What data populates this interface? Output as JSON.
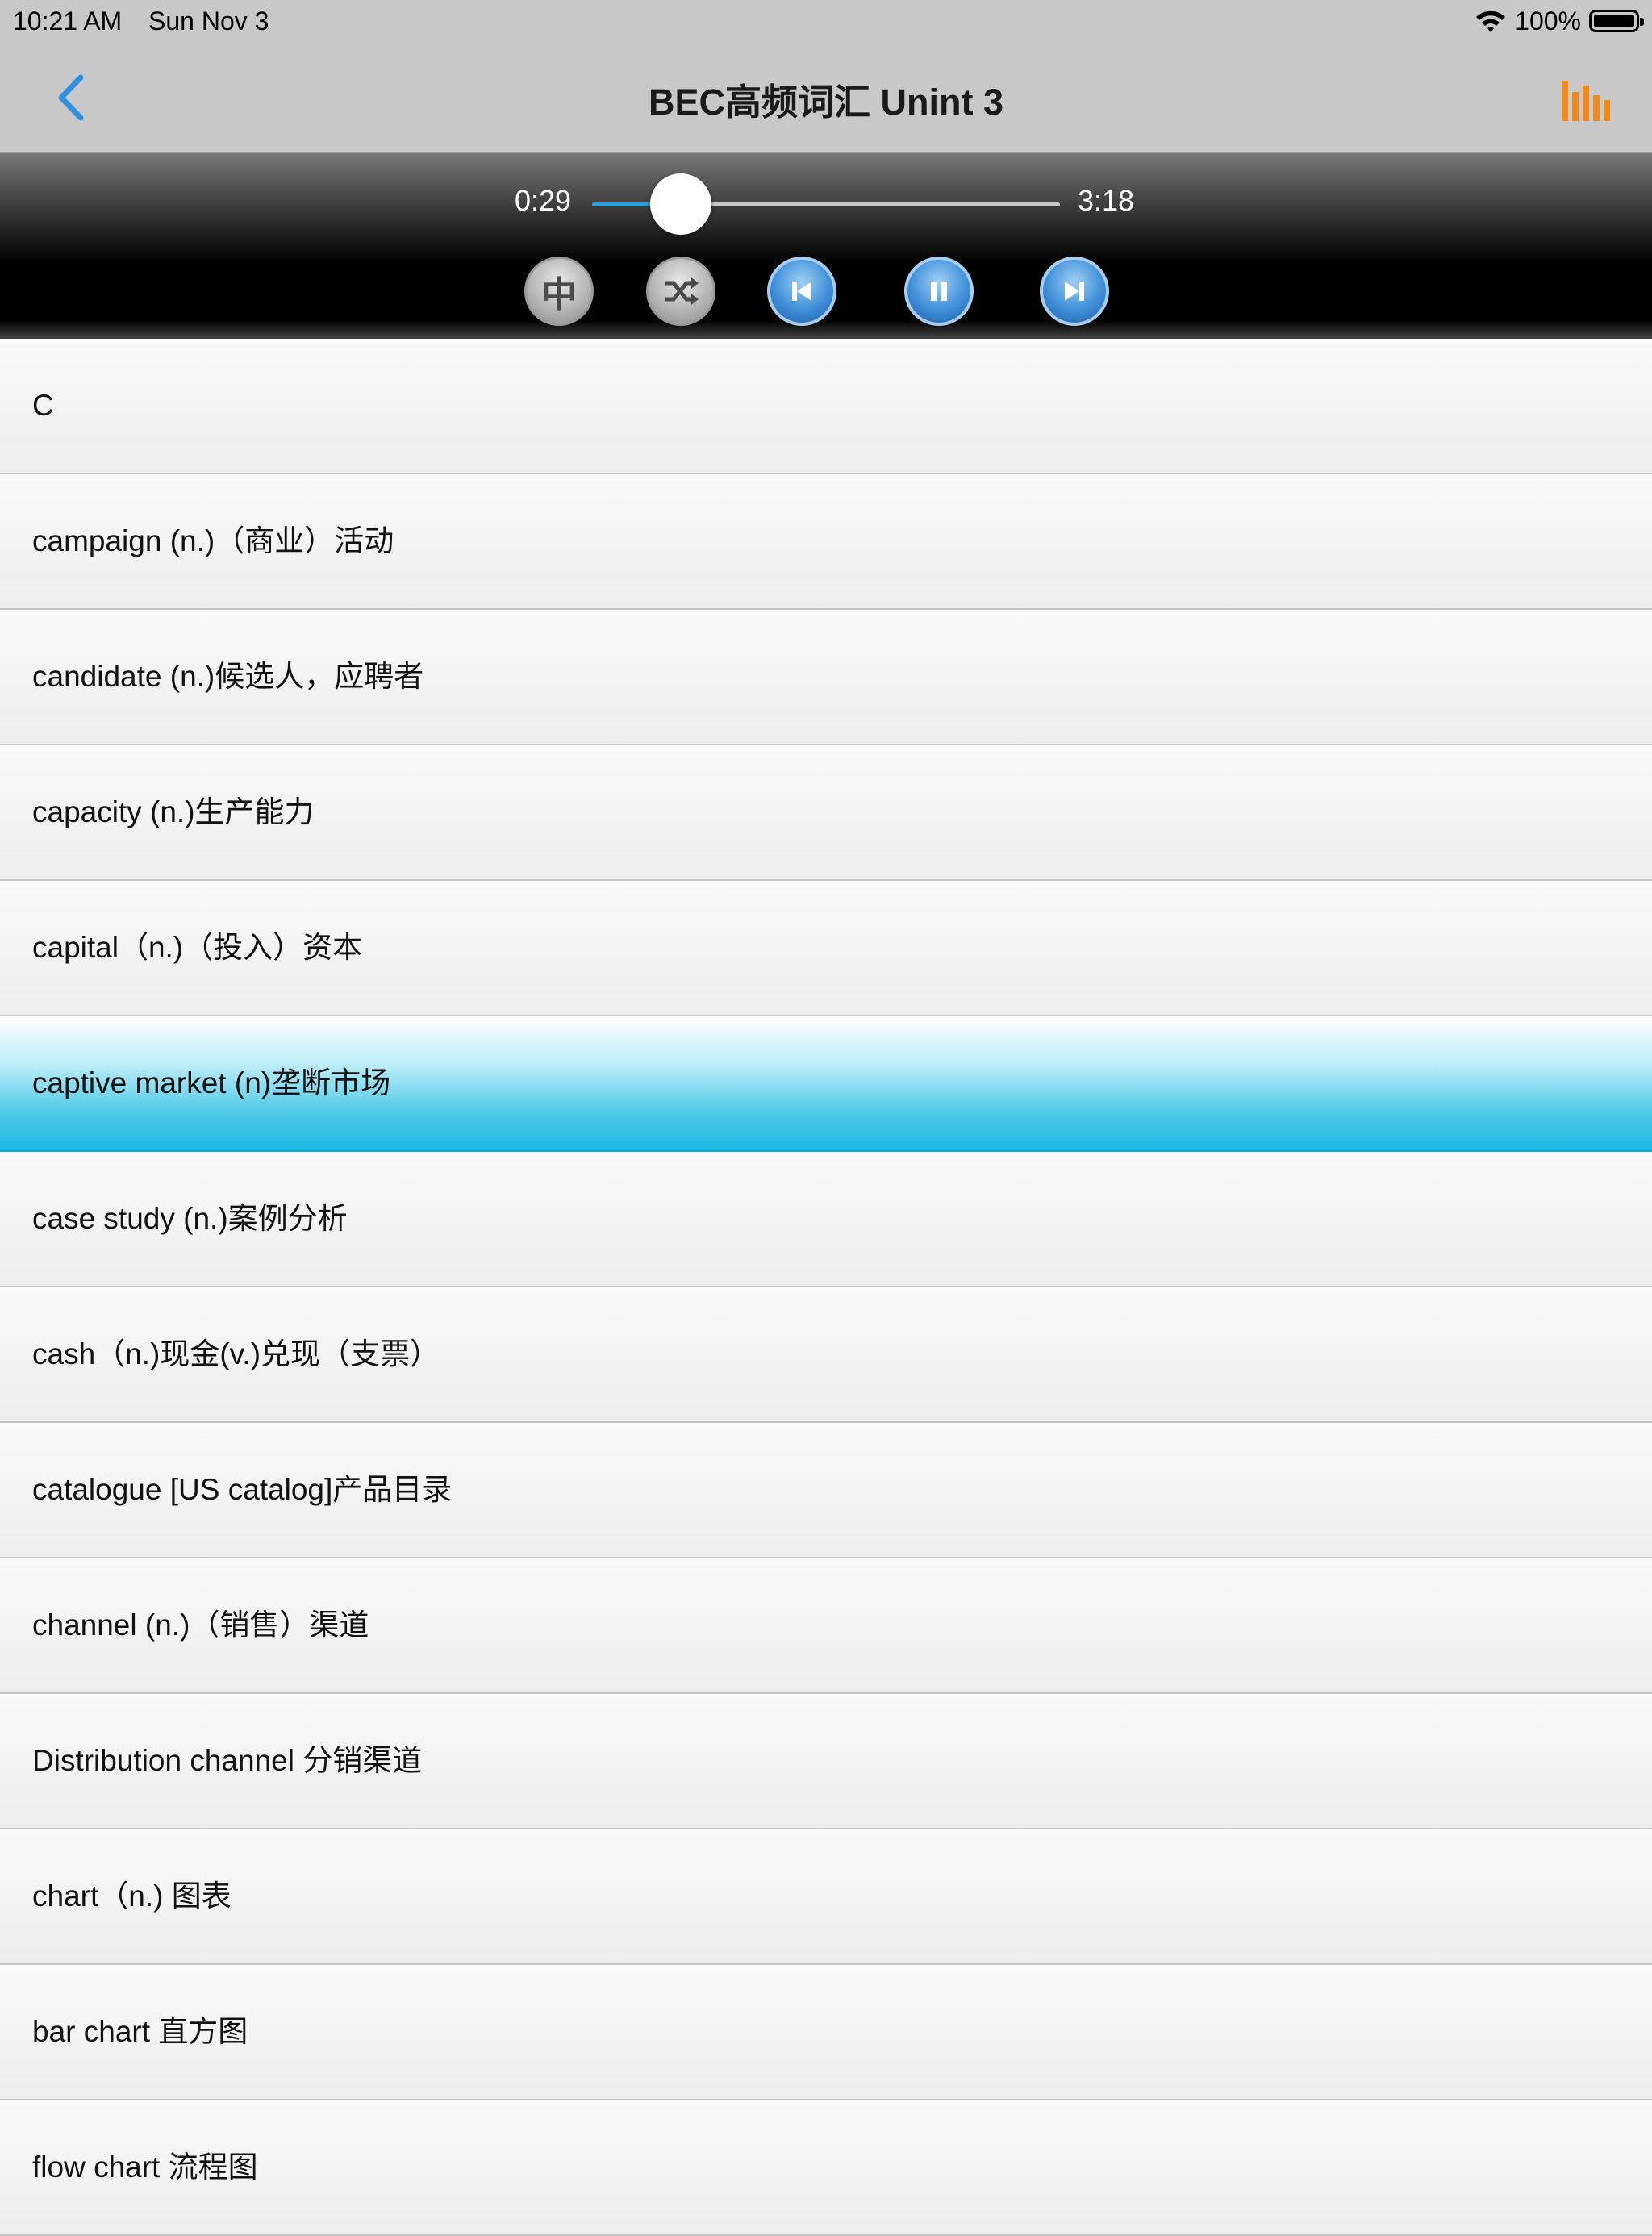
{
  "status_bar": {
    "time": "10:21 AM",
    "date": "Sun Nov 3",
    "battery": "100%"
  },
  "nav": {
    "title": "BEC高频词汇 Unint 3"
  },
  "player": {
    "current_time": "0:29",
    "total_time": "3:18",
    "progress": 0.19,
    "chinese_toggle_label": "中"
  },
  "colors": {
    "accent_blue": "#2a9ce0",
    "stats_orange": "#f08a1c",
    "selected_row": "#1ab6df"
  },
  "icons": {
    "back": "chevron-left-icon",
    "stats": "bar-chart-icon",
    "shuffle": "shuffle-icon",
    "previous": "skip-previous-icon",
    "pause": "pause-icon",
    "next": "skip-next-icon"
  },
  "words": [
    {
      "text": "C",
      "selected": false
    },
    {
      "text": "campaign (n.)（商业）活动",
      "selected": false
    },
    {
      "text": "candidate (n.)候选人，应聘者",
      "selected": false
    },
    {
      "text": "capacity (n.)生产能力",
      "selected": false
    },
    {
      "text": "capital（n.)（投入）资本",
      "selected": false
    },
    {
      "text": "captive market (n)垄断市场",
      "selected": true
    },
    {
      "text": "case study (n.)案例分析",
      "selected": false
    },
    {
      "text": "cash（n.)现金(v.)兑现（支票）",
      "selected": false
    },
    {
      "text": "catalogue [US catalog]产品目录",
      "selected": false
    },
    {
      "text": "channel (n.)（销售）渠道",
      "selected": false
    },
    {
      "text": "Distribution channel 分销渠道",
      "selected": false
    },
    {
      "text": "chart（n.) 图表",
      "selected": false
    },
    {
      "text": "bar chart 直方图",
      "selected": false
    },
    {
      "text": "flow chart 流程图",
      "selected": false
    }
  ]
}
